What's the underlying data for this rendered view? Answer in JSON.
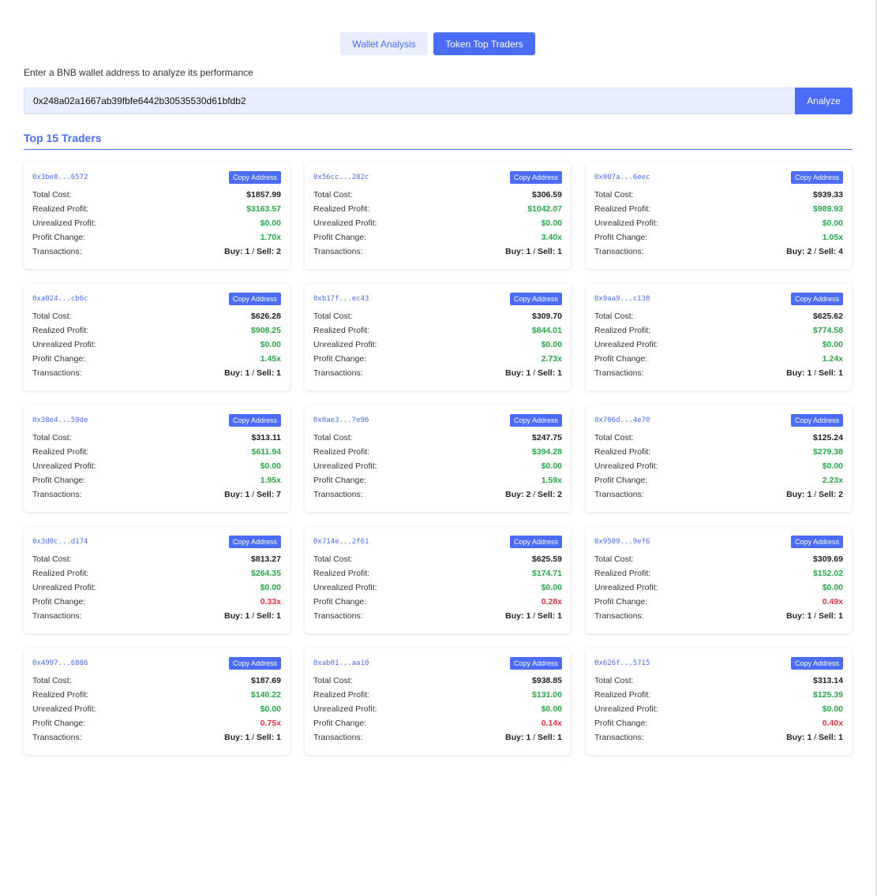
{
  "tabs": [
    {
      "label": "Wallet Analysis",
      "active": false
    },
    {
      "label": "Token Top Traders",
      "active": true
    }
  ],
  "prompt": "Enter a BNB wallet address to analyze its performance",
  "search": {
    "value": "0x248a02a1667ab39fbfe6442b30535530d61bfdb2",
    "button_label": "Analyze"
  },
  "section_title": "Top 15 Traders",
  "card_labels": {
    "copy": "Copy Address",
    "total_cost": "Total Cost:",
    "realized": "Realized Profit:",
    "unrealized": "Unrealized Profit:",
    "change": "Profit Change:",
    "transactions": "Transactions:",
    "buy": "Buy:",
    "sell": "Sell:",
    "sep": " / "
  },
  "colors": {
    "accent": "#4a6cf7",
    "positive": "#28a745",
    "negative": "#dc3545"
  },
  "traders": [
    {
      "address": "0x3be8...6572",
      "total_cost": "$1857.99",
      "realized": "$3163.57",
      "unrealized": "$0.00",
      "change": "1.70x",
      "buy": "1",
      "sell": "2"
    },
    {
      "address": "0x56cc...282c",
      "total_cost": "$306.59",
      "realized": "$1042.07",
      "unrealized": "$0.00",
      "change": "3.40x",
      "buy": "1",
      "sell": "1"
    },
    {
      "address": "0x007a...6eec",
      "total_cost": "$939.33",
      "realized": "$989.93",
      "unrealized": "$0.00",
      "change": "1.05x",
      "buy": "2",
      "sell": "4"
    },
    {
      "address": "0xa024...cb6c",
      "total_cost": "$626.28",
      "realized": "$908.25",
      "unrealized": "$0.00",
      "change": "1.45x",
      "buy": "1",
      "sell": "1"
    },
    {
      "address": "0xb17f...ec43",
      "total_cost": "$309.70",
      "realized": "$844.01",
      "unrealized": "$0.00",
      "change": "2.73x",
      "buy": "1",
      "sell": "1"
    },
    {
      "address": "0x9aa9...c130",
      "total_cost": "$625.62",
      "realized": "$774.58",
      "unrealized": "$0.00",
      "change": "1.24x",
      "buy": "1",
      "sell": "1"
    },
    {
      "address": "0x38e4...59de",
      "total_cost": "$313.11",
      "realized": "$611.94",
      "unrealized": "$0.00",
      "change": "1.95x",
      "buy": "1",
      "sell": "7"
    },
    {
      "address": "0x0ae3...7e96",
      "total_cost": "$247.75",
      "realized": "$394.28",
      "unrealized": "$0.00",
      "change": "1.59x",
      "buy": "2",
      "sell": "2"
    },
    {
      "address": "0x706d...4e70",
      "total_cost": "$125.24",
      "realized": "$279.38",
      "unrealized": "$0.00",
      "change": "2.23x",
      "buy": "1",
      "sell": "2"
    },
    {
      "address": "0x3d0c...d174",
      "total_cost": "$813.27",
      "realized": "$264.35",
      "unrealized": "$0.00",
      "change": "0.33x",
      "buy": "1",
      "sell": "1"
    },
    {
      "address": "0x714e...2f61",
      "total_cost": "$625.59",
      "realized": "$174.71",
      "unrealized": "$0.00",
      "change": "0.28x",
      "buy": "1",
      "sell": "1"
    },
    {
      "address": "0x9509...9ef6",
      "total_cost": "$309.69",
      "realized": "$152.02",
      "unrealized": "$0.00",
      "change": "0.49x",
      "buy": "1",
      "sell": "1"
    },
    {
      "address": "0x4997...6886",
      "total_cost": "$187.69",
      "realized": "$140.22",
      "unrealized": "$0.00",
      "change": "0.75x",
      "buy": "1",
      "sell": "1"
    },
    {
      "address": "0xab01...aa10",
      "total_cost": "$938.85",
      "realized": "$131.00",
      "unrealized": "$0.00",
      "change": "0.14x",
      "buy": "1",
      "sell": "1"
    },
    {
      "address": "0x626f...5715",
      "total_cost": "$313.14",
      "realized": "$125.39",
      "unrealized": "$0.00",
      "change": "0.40x",
      "buy": "1",
      "sell": "1"
    }
  ]
}
